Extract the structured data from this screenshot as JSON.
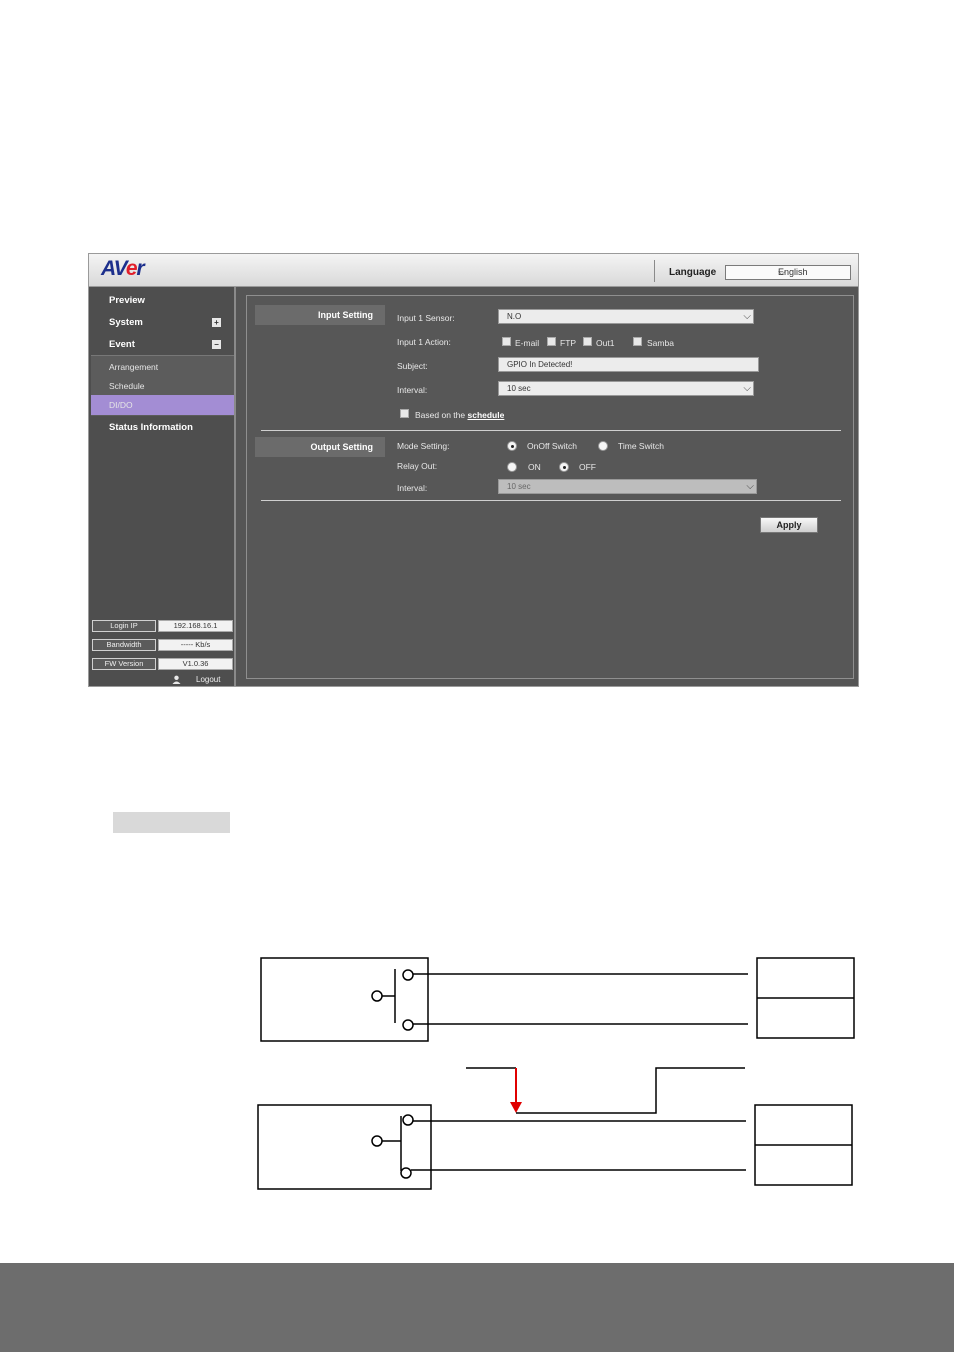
{
  "app": {
    "logo_text_a": "AV",
    "logo_text_e": "e",
    "logo_text_r": "r",
    "language_label": "Language",
    "language_value": "English"
  },
  "sidebar": {
    "preview": "Preview",
    "system": "System",
    "event": "Event",
    "sub_items": [
      "Arrangement",
      "Schedule",
      "DI/DO"
    ],
    "status": "Status Information",
    "info": {
      "login_ip_label": "Login IP",
      "login_ip_value": "192.168.16.1",
      "bandwidth_label": "Bandwidth",
      "bandwidth_value": "----- Kb/s",
      "fw_label": "FW Version",
      "fw_value": "V1.0.36"
    },
    "logout": "Logout"
  },
  "input_setting": {
    "title": "Input Setting",
    "sensor_label": "Input 1 Sensor:",
    "sensor_value": "N.O",
    "action_label": "Input 1 Action:",
    "actions": [
      "E-mail",
      "FTP",
      "Out1",
      "Samba"
    ],
    "subject_label": "Subject:",
    "subject_value": "GPIO In Detected!",
    "interval_label": "Interval:",
    "interval_value": "10 sec",
    "schedule_prefix": "Based on the",
    "schedule_link": "schedule"
  },
  "output_setting": {
    "title": "Output Setting",
    "mode_label": "Mode Setting:",
    "mode_options": [
      "OnOff Switch",
      "Time Switch"
    ],
    "relay_label": "Relay Out:",
    "relay_options": [
      "ON",
      "OFF"
    ],
    "interval_label": "Interval:",
    "interval_value": "10 sec"
  },
  "apply_label": "Apply",
  "colors": {
    "logo_blue": "#1c2f8c",
    "logo_red": "#e11f2b",
    "active_item": "#a38dd4",
    "arrow_red": "#e00000"
  }
}
